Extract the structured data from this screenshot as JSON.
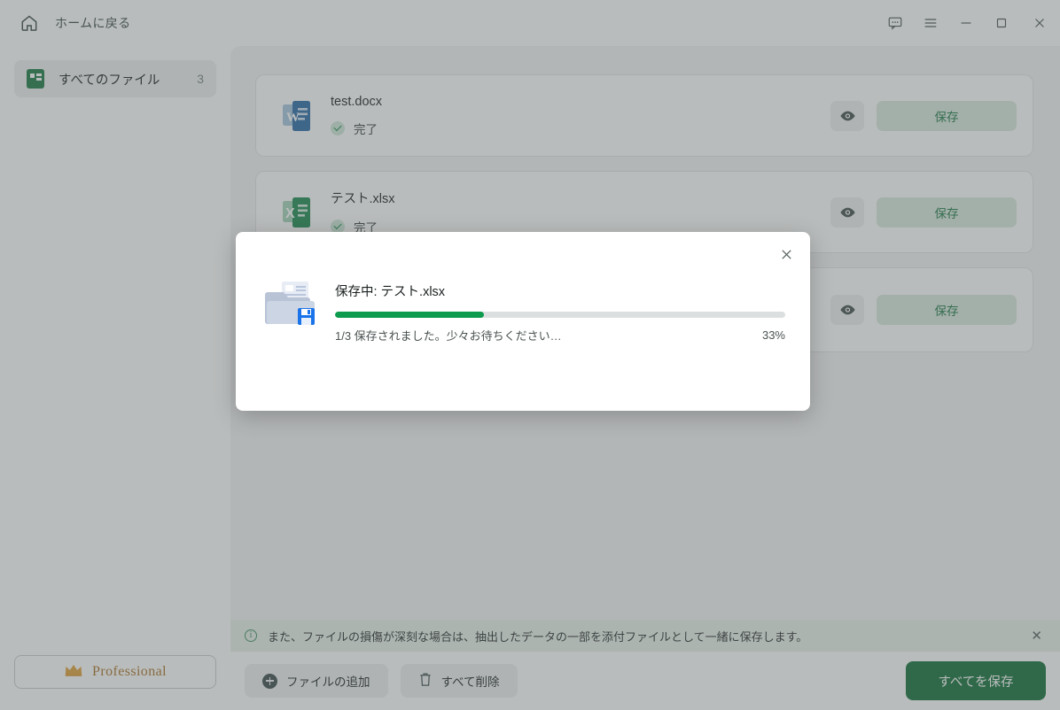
{
  "titlebar": {
    "home_label": "ホームに戻る",
    "home_icon": "home-icon",
    "controls": [
      {
        "name": "feedback-icon",
        "label": "feedback"
      },
      {
        "name": "menu-icon",
        "label": "menu"
      },
      {
        "name": "minimize-icon",
        "label": "minimize"
      },
      {
        "name": "maximize-icon",
        "label": "maximize"
      },
      {
        "name": "close-icon",
        "label": "close"
      }
    ]
  },
  "sidebar": {
    "item_label": "すべてのファイル",
    "item_count": "3",
    "pro_label": "Professional",
    "pro_icon": "crown-icon"
  },
  "files": [
    {
      "name": "test.docx",
      "status": "完了",
      "icon": "word-icon",
      "preview_icon": "eye-icon",
      "save_label": "保存"
    },
    {
      "name": "テスト.xlsx",
      "status": "完了",
      "icon": "excel-icon",
      "preview_icon": "eye-icon",
      "save_label": "保存"
    },
    {
      "name": "",
      "status": "",
      "icon": "file-icon",
      "preview_icon": "eye-icon",
      "save_label": "保存"
    }
  ],
  "info_banner": {
    "icon": "info-icon",
    "text": "また、ファイルの損傷が深刻な場合は、抽出したデータの一部を添付ファイルとして一緒に保存します。",
    "close": "✕"
  },
  "bottombar": {
    "add_file_label": "ファイルの追加",
    "delete_all_label": "すべて削除",
    "save_all_label": "すべてを保存"
  },
  "dialog": {
    "close": "✕",
    "icon": "folder-save-icon",
    "title": "保存中: テスト.xlsx",
    "subtext": "1/3 保存されました。少々お待ちください…",
    "percent_label": "33%",
    "progress_value": 33
  },
  "colors": {
    "brand_green": "#137039",
    "progress_green": "#0d9b4e",
    "save_btn_bg": "#d9e8de",
    "banner_bg": "#e8f2ea",
    "content_bg": "#f4f5f6",
    "pro_gold": "#a9742b"
  }
}
